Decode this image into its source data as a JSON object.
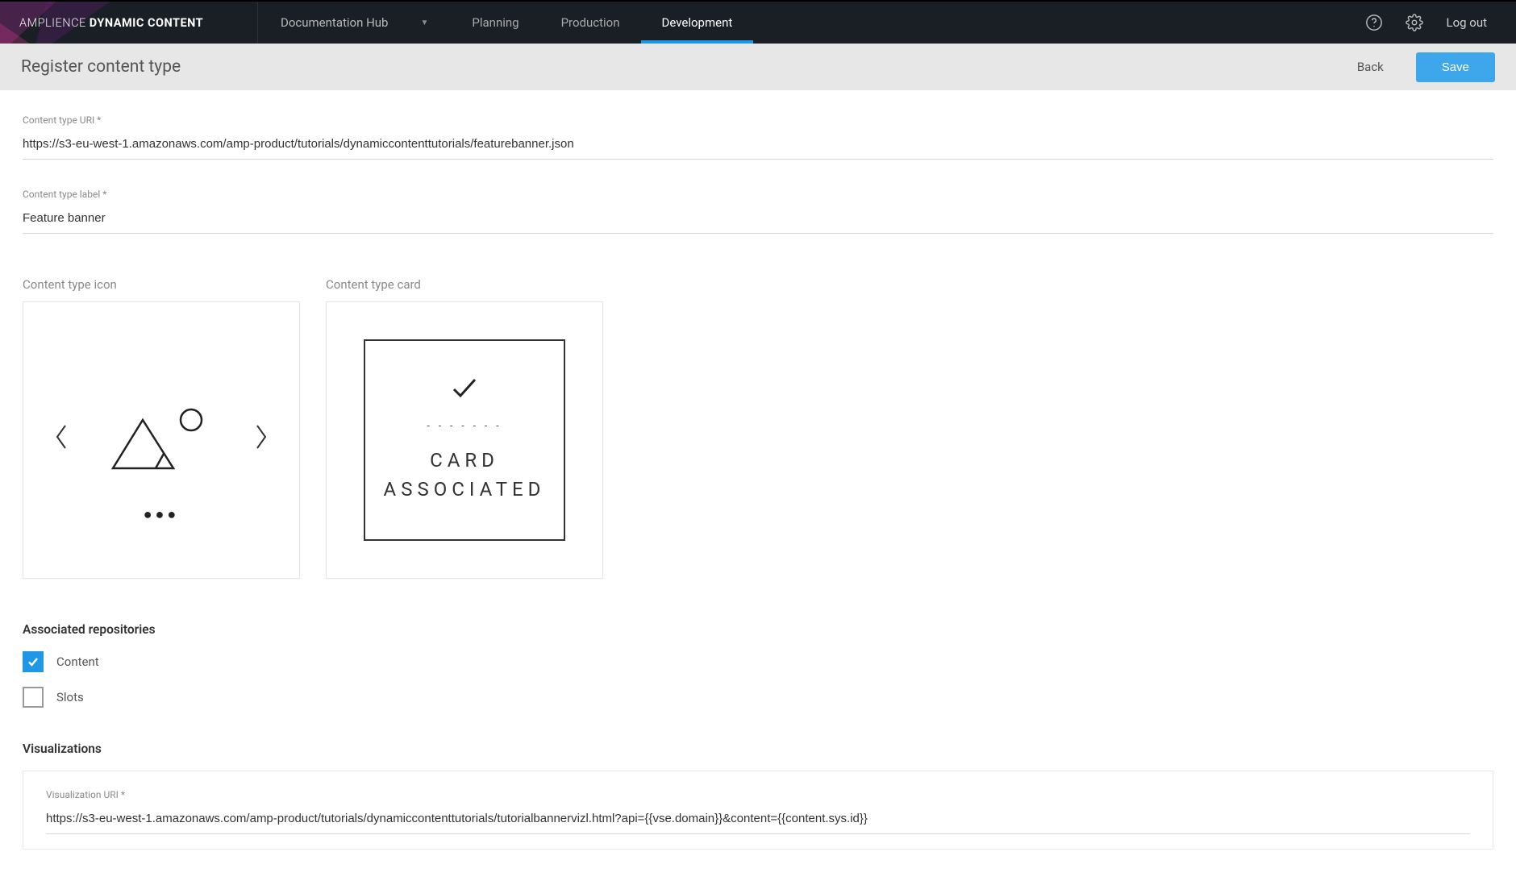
{
  "brand": {
    "light": "AMPLIENCE",
    "bold": "DYNAMIC CONTENT"
  },
  "hub": {
    "name": "Documentation Hub"
  },
  "nav": {
    "planning": "Planning",
    "production": "Production",
    "development": "Development"
  },
  "topbar": {
    "logout": "Log out"
  },
  "subheader": {
    "title": "Register content type",
    "back": "Back",
    "save": "Save"
  },
  "fields": {
    "uri_label": "Content type URI *",
    "uri_value": "https://s3-eu-west-1.amazonaws.com/amp-product/tutorials/dynamiccontenttutorials/featurebanner.json",
    "label_label": "Content type label *",
    "label_value": "Feature banner"
  },
  "icon_section": {
    "label": "Content type icon"
  },
  "card_section": {
    "label": "Content type card",
    "card_line1": "CARD",
    "card_line2": "ASSOCIATED"
  },
  "repos": {
    "heading": "Associated repositories",
    "content": "Content",
    "slots": "Slots"
  },
  "viz": {
    "heading": "Visualizations",
    "uri_label": "Visualization URI *",
    "uri_value": "https://s3-eu-west-1.amazonaws.com/amp-product/tutorials/dynamiccontenttutorials/tutorialbannervizl.html?api={{vse.domain}}&content={{content.sys.id}}"
  }
}
